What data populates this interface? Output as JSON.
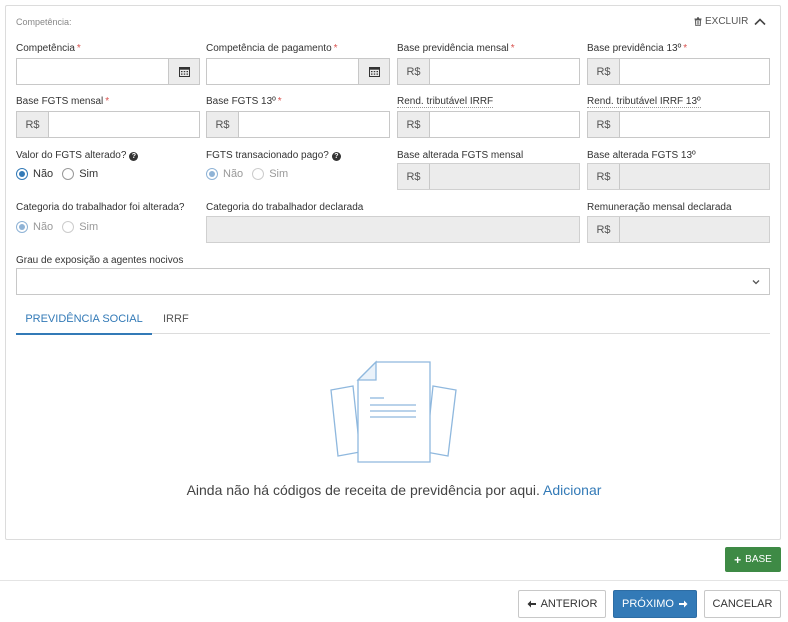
{
  "section": {
    "title": "Competência:",
    "delete_label": "EXCLUIR"
  },
  "fields": {
    "competencia": {
      "label": "Competência"
    },
    "competencia_pagamento": {
      "label": "Competência de pagamento"
    },
    "base_prev_mensal": {
      "label": "Base previdência mensal",
      "prefix": "R$"
    },
    "base_prev_13": {
      "label": "Base previdência 13º",
      "prefix": "R$"
    },
    "base_fgts_mensal": {
      "label": "Base FGTS mensal",
      "prefix": "R$"
    },
    "base_fgts_13": {
      "label": "Base FGTS 13º",
      "prefix": "R$"
    },
    "rend_irrf": {
      "label": "Rend. tributável IRRF",
      "prefix": "R$"
    },
    "rend_irrf_13": {
      "label": "Rend. tributável IRRF 13º",
      "prefix": "R$"
    },
    "base_alt_fgts_mensal": {
      "label": "Base alterada FGTS mensal",
      "prefix": "R$"
    },
    "base_alt_fgts_13": {
      "label": "Base alterada FGTS 13º",
      "prefix": "R$"
    },
    "categoria_declarada": {
      "label": "Categoria do trabalhador declarada"
    },
    "remuneracao_declarada": {
      "label": "Remuneração mensal declarada",
      "prefix": "R$"
    },
    "grau_exposicao": {
      "label": "Grau de exposição a agentes nocivos",
      "value": ""
    }
  },
  "radios": {
    "fgts_alterado": {
      "label": "Valor do FGTS alterado?",
      "options": [
        "Não",
        "Sim"
      ],
      "selected": "Não"
    },
    "fgts_pago": {
      "label": "FGTS transacionado pago?",
      "options": [
        "Não",
        "Sim"
      ],
      "selected": "Não"
    },
    "categoria_alterada": {
      "label": "Categoria do trabalhador foi alterada?",
      "options": [
        "Não",
        "Sim"
      ],
      "selected": "Não"
    }
  },
  "tabs": [
    {
      "label": "PREVIDÊNCIA SOCIAL",
      "active": true
    },
    {
      "label": "IRRF",
      "active": false
    }
  ],
  "empty_state": {
    "message": "Ainda não há códigos de receita de previdência por aqui.",
    "link": "Adicionar"
  },
  "buttons": {
    "add_base": "BASE",
    "previous": "ANTERIOR",
    "next": "PRÓXIMO",
    "cancel": "CANCELAR"
  },
  "colors": {
    "primary": "#337ab7",
    "success": "#3e8a45",
    "required": "#d9534f"
  }
}
